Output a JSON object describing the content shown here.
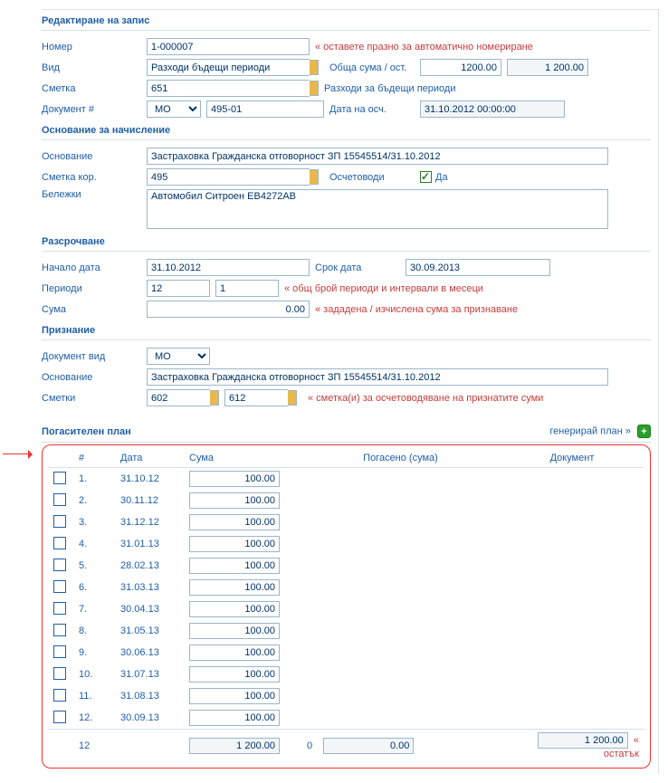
{
  "sections": {
    "edit_record": "Редактиране на запис",
    "accrual_basis": "Основание за начисление",
    "installments": "Разсрочване",
    "recognition": "Признание",
    "plan": "Погасителен план"
  },
  "labels": {
    "number": "Номер",
    "kind": "Вид",
    "account": "Сметка",
    "document_no": "Документ #",
    "total_rest": "Обща сума / ост.",
    "acc_date": "Дата на осч.",
    "basis": "Основание",
    "corr_account": "Сметка кор.",
    "posted": "Осчетоводи",
    "notes": "Бележки",
    "start_date": "Начало дата",
    "end_date": "Срок дата",
    "periods": "Периоди",
    "sum": "Сума",
    "doc_kind": "Документ вид",
    "accounts": "Сметки",
    "yes": "Да"
  },
  "hints": {
    "number": "« оставете празно за автоматично номериране",
    "periods": "« общ брой периоди и интервали в месеци",
    "sum": "« зададена / изчислена сума за признаване",
    "accounts": "« сметка(и) за осчетоводяване на признатите суми",
    "generate": "генерирай план »",
    "remainder": "« остатък"
  },
  "record": {
    "number": "1-000007",
    "kind": "Разходи бъдещи периоди",
    "account": "651",
    "account_desc": "Разходи за бъдещи периоди",
    "doc_type": "МО",
    "doc_no": "495-01",
    "acc_date": "31.10.2012 00:00:00",
    "total": "1200.00",
    "rest": "1 200.00"
  },
  "basis": {
    "text": "Застраховка Гражданска отговорност ЗП 15545514/31.10.2012",
    "corr_account": "495",
    "posted": true,
    "notes": "Автомобил Ситроен ЕВ4272АВ"
  },
  "install": {
    "start": "31.10.2012",
    "end": "30.09.2013",
    "periods": "12",
    "interval": "1",
    "sum": "0.00"
  },
  "recog": {
    "doc_kind": "МО",
    "basis": "Застраховка Гражданска отговорност ЗП 15545514/31.10.2012",
    "acc1": "602",
    "acc2": "612"
  },
  "plan": {
    "columns": {
      "n": "#",
      "date": "Дата",
      "sum": "Сума",
      "paid": "Погасено (сума)",
      "doc": "Документ"
    },
    "rows": [
      {
        "n": "1.",
        "date": "31.10.12",
        "sum": "100.00"
      },
      {
        "n": "2.",
        "date": "30.11.12",
        "sum": "100.00"
      },
      {
        "n": "3.",
        "date": "31.12.12",
        "sum": "100.00"
      },
      {
        "n": "4.",
        "date": "31.01.13",
        "sum": "100.00"
      },
      {
        "n": "5.",
        "date": "28.02.13",
        "sum": "100.00"
      },
      {
        "n": "6.",
        "date": "31.03.13",
        "sum": "100.00"
      },
      {
        "n": "7.",
        "date": "30.04.13",
        "sum": "100.00"
      },
      {
        "n": "8.",
        "date": "31.05.13",
        "sum": "100.00"
      },
      {
        "n": "9.",
        "date": "30.06.13",
        "sum": "100.00"
      },
      {
        "n": "10.",
        "date": "31.07.13",
        "sum": "100.00"
      },
      {
        "n": "11.",
        "date": "31.08.13",
        "sum": "100.00"
      },
      {
        "n": "12.",
        "date": "30.09.13",
        "sum": "100.00"
      }
    ],
    "totals": {
      "count": "12",
      "sum": "1 200.00",
      "paid_n": "0",
      "paid": "0.00",
      "doc_total": "1 200.00"
    }
  }
}
